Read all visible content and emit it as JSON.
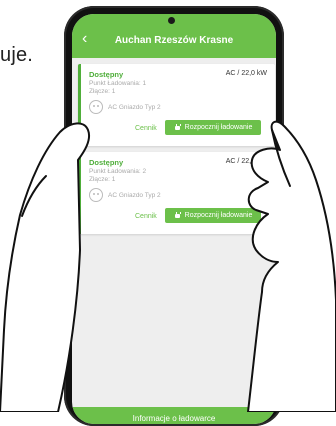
{
  "side_text": "uje.",
  "header": {
    "title": "Auchan Rzeszów Krasne",
    "back_icon": "chevron-left-icon"
  },
  "chargers": [
    {
      "status": "Dostępny",
      "power": "AC / 22,0 kW",
      "point": "Punkt Ładowania: 1",
      "connector": "Złącze: 1",
      "socket": "AC Gniazdo Typ 2",
      "price_link": "Cennik",
      "start_label": "Rozpocznij ładowanie"
    },
    {
      "status": "Dostępny",
      "power": "AC / 22,0 kW",
      "point": "Punkt Ładowania: 2",
      "connector": "Złącze: 1",
      "socket": "AC Gniazdo Typ 2",
      "price_link": "Cennik",
      "start_label": "Rozpocznij ładowanie"
    }
  ],
  "footer": {
    "info_label": "Informacje o ładowarce"
  },
  "colors": {
    "accent": "#6cc04a",
    "status": "#4fae3a"
  }
}
